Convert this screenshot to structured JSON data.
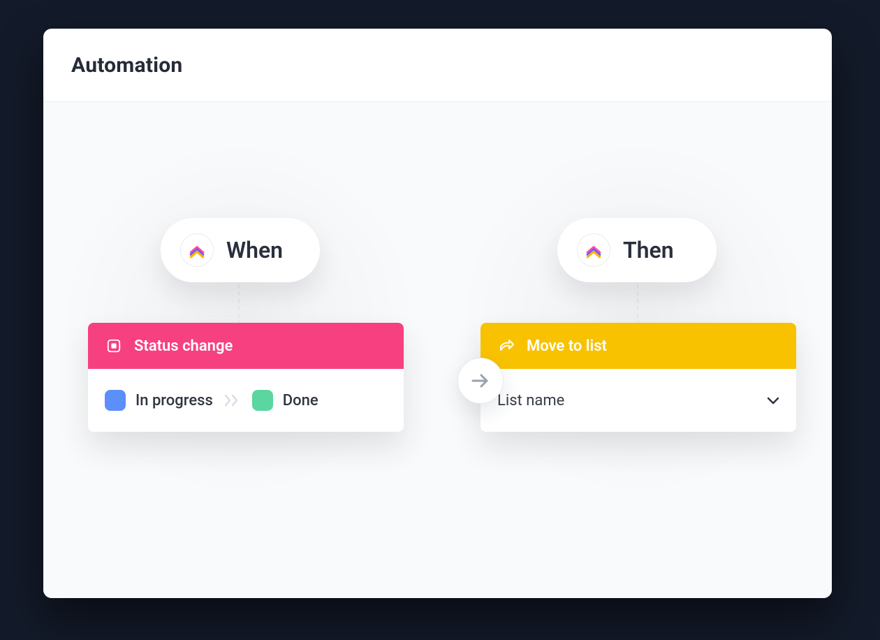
{
  "header": {
    "title": "Automation"
  },
  "when": {
    "label": "When"
  },
  "then": {
    "label": "Then"
  },
  "trigger": {
    "title": "Status change",
    "from": {
      "label": "In progress",
      "color": "#5b8ff9"
    },
    "to": {
      "label": "Done",
      "color": "#5bd6a0"
    },
    "header_color": "#f6407f"
  },
  "action": {
    "title": "Move to list",
    "select_label": "List name",
    "header_color": "#f8c200"
  },
  "colors": {
    "bg_dark": "#131a29",
    "panel_bg": "#ffffff",
    "body_bg": "#f9fafb"
  }
}
